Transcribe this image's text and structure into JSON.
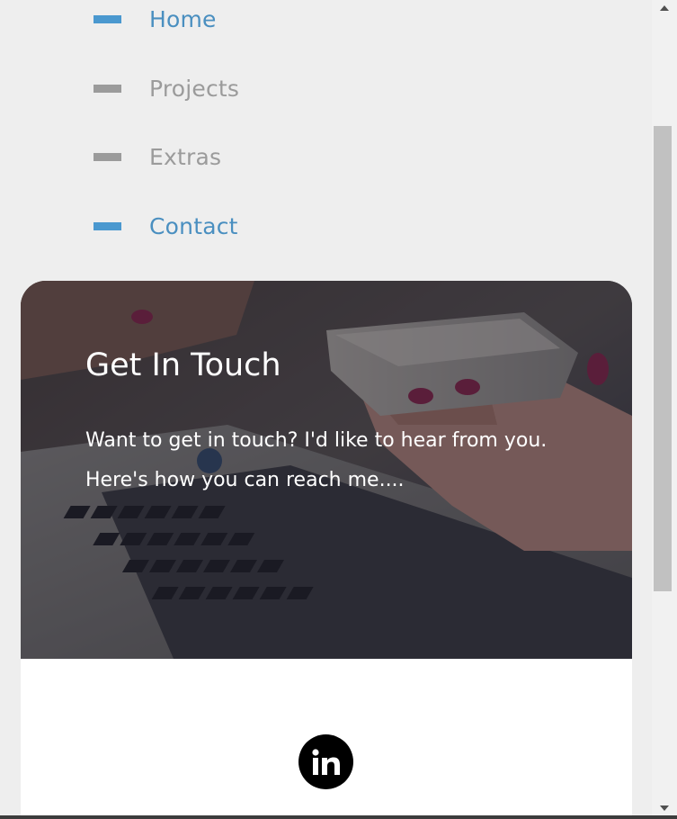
{
  "nav": {
    "items": [
      {
        "label": "Home",
        "active": true
      },
      {
        "label": "Projects",
        "active": false
      },
      {
        "label": "Extras",
        "active": false
      },
      {
        "label": "Contact",
        "active": true
      }
    ]
  },
  "hero": {
    "title": "Get In Touch",
    "line1": "Want to get in touch? I'd like to hear from you.",
    "line2": "Here's how you can reach me...."
  },
  "social": {
    "linkedin_icon": "linkedin-icon",
    "linkedin_text": "in"
  },
  "colors": {
    "accent": "#4a98cf",
    "nav_inactive": "#9b9b9b",
    "page_bg": "#eeeeee"
  }
}
